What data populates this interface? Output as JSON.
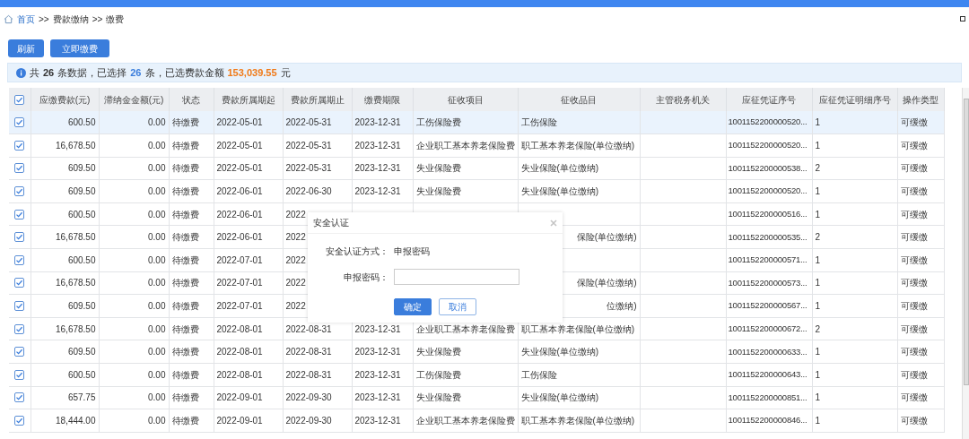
{
  "breadcrumb": [
    {
      "text": "首页",
      "kind": "link"
    },
    {
      "text": ">>",
      "kind": "sep"
    },
    {
      "text": "费款缴纳",
      "kind": "plain"
    },
    {
      "text": ">>",
      "kind": "sep"
    },
    {
      "text": "缴费",
      "kind": "plain"
    }
  ],
  "buttons": [
    "刷新",
    "立即缴费"
  ],
  "info": [
    {
      "text": "共",
      "kind": "plain"
    },
    {
      "text": "26",
      "kind": "total"
    },
    {
      "text": "条数据，已选择",
      "kind": "plain"
    },
    {
      "text": "26",
      "kind": "selected"
    },
    {
      "text": "条，已选费款金额",
      "kind": "plain"
    },
    {
      "text": "153,039.55",
      "kind": "amount"
    },
    {
      "text": "元",
      "kind": "plain"
    }
  ],
  "table": {
    "all_checked": true,
    "columns": [
      "应缴费款(元)",
      "滞纳金金额(元)",
      "状态",
      "费款所属期起",
      "费款所属期止",
      "缴费期限",
      "征收项目",
      "征收品目",
      "主管税务机关",
      "应征凭证序号",
      "应征凭证明细序号",
      "操作类型"
    ],
    "rows": [
      {
        "checked": true,
        "selected": true,
        "cells": [
          "600.50",
          "0.00",
          "待缴费",
          "2022-05-01",
          "2022-05-31",
          "2023-12-31",
          "工伤保险费",
          "工伤保险",
          "",
          "1001152200000520...",
          "1",
          "可缓缴"
        ]
      },
      {
        "checked": true,
        "selected": false,
        "cells": [
          "16,678.50",
          "0.00",
          "待缴费",
          "2022-05-01",
          "2022-05-31",
          "2023-12-31",
          "企业职工基本养老保险费",
          "职工基本养老保险(单位缴纳)",
          "",
          "1001152200000520...",
          "1",
          "可缓缴"
        ]
      },
      {
        "checked": true,
        "selected": false,
        "cells": [
          "609.50",
          "0.00",
          "待缴费",
          "2022-05-01",
          "2022-05-31",
          "2023-12-31",
          "失业保险费",
          "失业保险(单位缴纳)",
          "",
          "1001152200000538...",
          "2",
          "可缓缴"
        ]
      },
      {
        "checked": true,
        "selected": false,
        "cells": [
          "609.50",
          "0.00",
          "待缴费",
          "2022-06-01",
          "2022-06-30",
          "2023-12-31",
          "失业保险费",
          "失业保险(单位缴纳)",
          "",
          "1001152200000520...",
          "1",
          "可缓缴"
        ]
      },
      {
        "checked": true,
        "selected": false,
        "cells": [
          "600.50",
          "0.00",
          "待缴费",
          "2022-06-01",
          "2022",
          "",
          "",
          "",
          "",
          "1001152200000516...",
          "1",
          "可缓缴"
        ]
      },
      {
        "checked": true,
        "selected": false,
        "cells": [
          "16,678.50",
          "0.00",
          "待缴费",
          "2022-06-01",
          "2022",
          "",
          "",
          {
            "text": "保险(单位缴纳)",
            "covered_left": true
          },
          "",
          "1001152200000535...",
          "2",
          "可缓缴"
        ]
      },
      {
        "checked": true,
        "selected": false,
        "cells": [
          "600.50",
          "0.00",
          "待缴费",
          "2022-07-01",
          "2022",
          "",
          "",
          "",
          "",
          "1001152200000571...",
          "1",
          "可缓缴"
        ]
      },
      {
        "checked": true,
        "selected": false,
        "cells": [
          "16,678.50",
          "0.00",
          "待缴费",
          "2022-07-01",
          "2022",
          "",
          "",
          {
            "text": "保险(单位缴纳)",
            "covered_left": true
          },
          "",
          "1001152200000573...",
          "1",
          "可缓缴"
        ]
      },
      {
        "checked": true,
        "selected": false,
        "cells": [
          "609.50",
          "0.00",
          "待缴费",
          "2022-07-01",
          "2022",
          "",
          "",
          {
            "text": "位缴纳)",
            "covered_left": true
          },
          "",
          "1001152200000567...",
          "1",
          "可缓缴"
        ]
      },
      {
        "checked": true,
        "selected": false,
        "cells": [
          "16,678.50",
          "0.00",
          "待缴费",
          "2022-08-01",
          "2022-08-31",
          "2023-12-31",
          "企业职工基本养老保险费",
          "职工基本养老保险(单位缴纳)",
          "",
          "1001152200000672...",
          "2",
          "可缓缴"
        ]
      },
      {
        "checked": true,
        "selected": false,
        "cells": [
          "609.50",
          "0.00",
          "待缴费",
          "2022-08-01",
          "2022-08-31",
          "2023-12-31",
          "失业保险费",
          "失业保险(单位缴纳)",
          "",
          "1001152200000633...",
          "1",
          "可缓缴"
        ]
      },
      {
        "checked": true,
        "selected": false,
        "cells": [
          "600.50",
          "0.00",
          "待缴费",
          "2022-08-01",
          "2022-08-31",
          "2023-12-31",
          "工伤保险费",
          "工伤保险",
          "",
          "1001152200000643...",
          "1",
          "可缓缴"
        ]
      },
      {
        "checked": true,
        "selected": false,
        "cells": [
          "657.75",
          "0.00",
          "待缴费",
          "2022-09-01",
          "2022-09-30",
          "2023-12-31",
          "失业保险费",
          "失业保险(单位缴纳)",
          "",
          "1001152200000851...",
          "1",
          "可缓缴"
        ]
      },
      {
        "checked": true,
        "selected": false,
        "cells": [
          "18,444.00",
          "0.00",
          "待缴费",
          "2022-09-01",
          "2022-09-30",
          "2023-12-31",
          "企业职工基本养老保险费",
          "职工基本养老保险(单位缴纳)",
          "",
          "1001152200000846...",
          "1",
          "可缓缴"
        ]
      }
    ]
  },
  "dialog": {
    "title": "安全认证",
    "method_label": "安全认证方式：",
    "method_value": "申报密码",
    "password_label": "申报密码：",
    "buttons": [
      {
        "text": "确定",
        "kind": "primary"
      },
      {
        "text": "取消",
        "kind": "secondary"
      }
    ]
  }
}
